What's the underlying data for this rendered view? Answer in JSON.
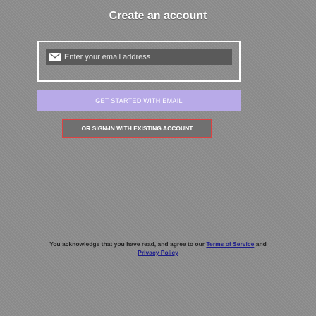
{
  "header": {
    "title": "Create an account"
  },
  "email_form": {
    "icon": "mail-icon",
    "placeholder": "Enter your email address",
    "value": ""
  },
  "actions": {
    "get_started_label": "GET STARTED WITH EMAIL",
    "sign_in_label": "OR SIGN-IN WITH EXISTING ACCOUNT"
  },
  "legal": {
    "prefix": "You acknowledge that you have read, and agree to our ",
    "terms_label": "Terms of Service",
    "conjunction": " and ",
    "privacy_label": "Privacy Policy"
  },
  "colors": {
    "background": "#8f8f8f",
    "primary_button": "#b8aae8",
    "secondary_border": "#dd4242",
    "input_background": "#5a5a5a",
    "link": "#1d1d8c"
  }
}
